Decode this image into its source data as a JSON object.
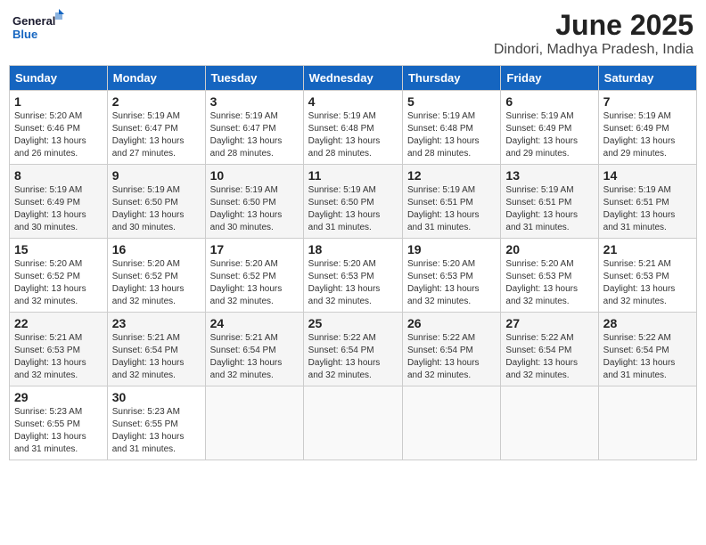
{
  "logo": {
    "line1": "General",
    "line2": "Blue"
  },
  "title": "June 2025",
  "location": "Dindori, Madhya Pradesh, India",
  "days_of_week": [
    "Sunday",
    "Monday",
    "Tuesday",
    "Wednesday",
    "Thursday",
    "Friday",
    "Saturday"
  ],
  "weeks": [
    [
      {
        "day": "1",
        "info": "Sunrise: 5:20 AM\nSunset: 6:46 PM\nDaylight: 13 hours\nand 26 minutes."
      },
      {
        "day": "2",
        "info": "Sunrise: 5:19 AM\nSunset: 6:47 PM\nDaylight: 13 hours\nand 27 minutes."
      },
      {
        "day": "3",
        "info": "Sunrise: 5:19 AM\nSunset: 6:47 PM\nDaylight: 13 hours\nand 28 minutes."
      },
      {
        "day": "4",
        "info": "Sunrise: 5:19 AM\nSunset: 6:48 PM\nDaylight: 13 hours\nand 28 minutes."
      },
      {
        "day": "5",
        "info": "Sunrise: 5:19 AM\nSunset: 6:48 PM\nDaylight: 13 hours\nand 28 minutes."
      },
      {
        "day": "6",
        "info": "Sunrise: 5:19 AM\nSunset: 6:49 PM\nDaylight: 13 hours\nand 29 minutes."
      },
      {
        "day": "7",
        "info": "Sunrise: 5:19 AM\nSunset: 6:49 PM\nDaylight: 13 hours\nand 29 minutes."
      }
    ],
    [
      {
        "day": "8",
        "info": "Sunrise: 5:19 AM\nSunset: 6:49 PM\nDaylight: 13 hours\nand 30 minutes."
      },
      {
        "day": "9",
        "info": "Sunrise: 5:19 AM\nSunset: 6:50 PM\nDaylight: 13 hours\nand 30 minutes."
      },
      {
        "day": "10",
        "info": "Sunrise: 5:19 AM\nSunset: 6:50 PM\nDaylight: 13 hours\nand 30 minutes."
      },
      {
        "day": "11",
        "info": "Sunrise: 5:19 AM\nSunset: 6:50 PM\nDaylight: 13 hours\nand 31 minutes."
      },
      {
        "day": "12",
        "info": "Sunrise: 5:19 AM\nSunset: 6:51 PM\nDaylight: 13 hours\nand 31 minutes."
      },
      {
        "day": "13",
        "info": "Sunrise: 5:19 AM\nSunset: 6:51 PM\nDaylight: 13 hours\nand 31 minutes."
      },
      {
        "day": "14",
        "info": "Sunrise: 5:19 AM\nSunset: 6:51 PM\nDaylight: 13 hours\nand 31 minutes."
      }
    ],
    [
      {
        "day": "15",
        "info": "Sunrise: 5:20 AM\nSunset: 6:52 PM\nDaylight: 13 hours\nand 32 minutes."
      },
      {
        "day": "16",
        "info": "Sunrise: 5:20 AM\nSunset: 6:52 PM\nDaylight: 13 hours\nand 32 minutes."
      },
      {
        "day": "17",
        "info": "Sunrise: 5:20 AM\nSunset: 6:52 PM\nDaylight: 13 hours\nand 32 minutes."
      },
      {
        "day": "18",
        "info": "Sunrise: 5:20 AM\nSunset: 6:53 PM\nDaylight: 13 hours\nand 32 minutes."
      },
      {
        "day": "19",
        "info": "Sunrise: 5:20 AM\nSunset: 6:53 PM\nDaylight: 13 hours\nand 32 minutes."
      },
      {
        "day": "20",
        "info": "Sunrise: 5:20 AM\nSunset: 6:53 PM\nDaylight: 13 hours\nand 32 minutes."
      },
      {
        "day": "21",
        "info": "Sunrise: 5:21 AM\nSunset: 6:53 PM\nDaylight: 13 hours\nand 32 minutes."
      }
    ],
    [
      {
        "day": "22",
        "info": "Sunrise: 5:21 AM\nSunset: 6:53 PM\nDaylight: 13 hours\nand 32 minutes."
      },
      {
        "day": "23",
        "info": "Sunrise: 5:21 AM\nSunset: 6:54 PM\nDaylight: 13 hours\nand 32 minutes."
      },
      {
        "day": "24",
        "info": "Sunrise: 5:21 AM\nSunset: 6:54 PM\nDaylight: 13 hours\nand 32 minutes."
      },
      {
        "day": "25",
        "info": "Sunrise: 5:22 AM\nSunset: 6:54 PM\nDaylight: 13 hours\nand 32 minutes."
      },
      {
        "day": "26",
        "info": "Sunrise: 5:22 AM\nSunset: 6:54 PM\nDaylight: 13 hours\nand 32 minutes."
      },
      {
        "day": "27",
        "info": "Sunrise: 5:22 AM\nSunset: 6:54 PM\nDaylight: 13 hours\nand 32 minutes."
      },
      {
        "day": "28",
        "info": "Sunrise: 5:22 AM\nSunset: 6:54 PM\nDaylight: 13 hours\nand 31 minutes."
      }
    ],
    [
      {
        "day": "29",
        "info": "Sunrise: 5:23 AM\nSunset: 6:55 PM\nDaylight: 13 hours\nand 31 minutes."
      },
      {
        "day": "30",
        "info": "Sunrise: 5:23 AM\nSunset: 6:55 PM\nDaylight: 13 hours\nand 31 minutes."
      },
      {
        "day": "",
        "info": ""
      },
      {
        "day": "",
        "info": ""
      },
      {
        "day": "",
        "info": ""
      },
      {
        "day": "",
        "info": ""
      },
      {
        "day": "",
        "info": ""
      }
    ]
  ]
}
